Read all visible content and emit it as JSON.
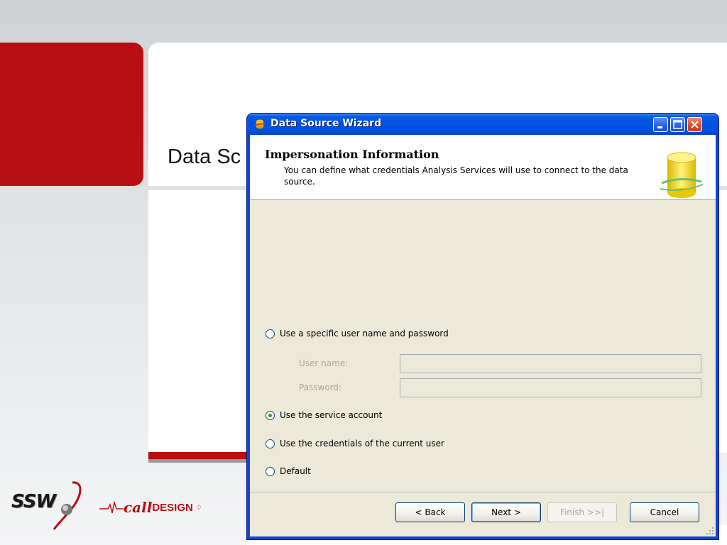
{
  "slide": {
    "title": "Data Sc"
  },
  "dialog": {
    "title": "Data Source Wizard",
    "header": {
      "title": "Impersonation Information",
      "description": "You can define what credentials Analysis Services will use to connect to the data source."
    },
    "options": [
      {
        "label": "Use a specific user name and password",
        "checked": false
      },
      {
        "label": "Use the service account",
        "checked": true
      },
      {
        "label": "Use the credentials of the current user",
        "checked": false
      },
      {
        "label": "Default",
        "checked": false
      }
    ],
    "fields": {
      "username_label": "User name:",
      "username_value": "",
      "password_label": "Password:",
      "password_value": ""
    },
    "buttons": {
      "back": "< Back",
      "next": "Next >",
      "finish": "Finish >>|",
      "cancel": "Cancel"
    }
  },
  "logos": {
    "ssw": "SSW",
    "call": "call",
    "design": "DESIGN"
  },
  "colors": {
    "brand_red": "#b80f12",
    "xp_blue": "#0252e0",
    "dialog_bg": "#ece9d8"
  }
}
